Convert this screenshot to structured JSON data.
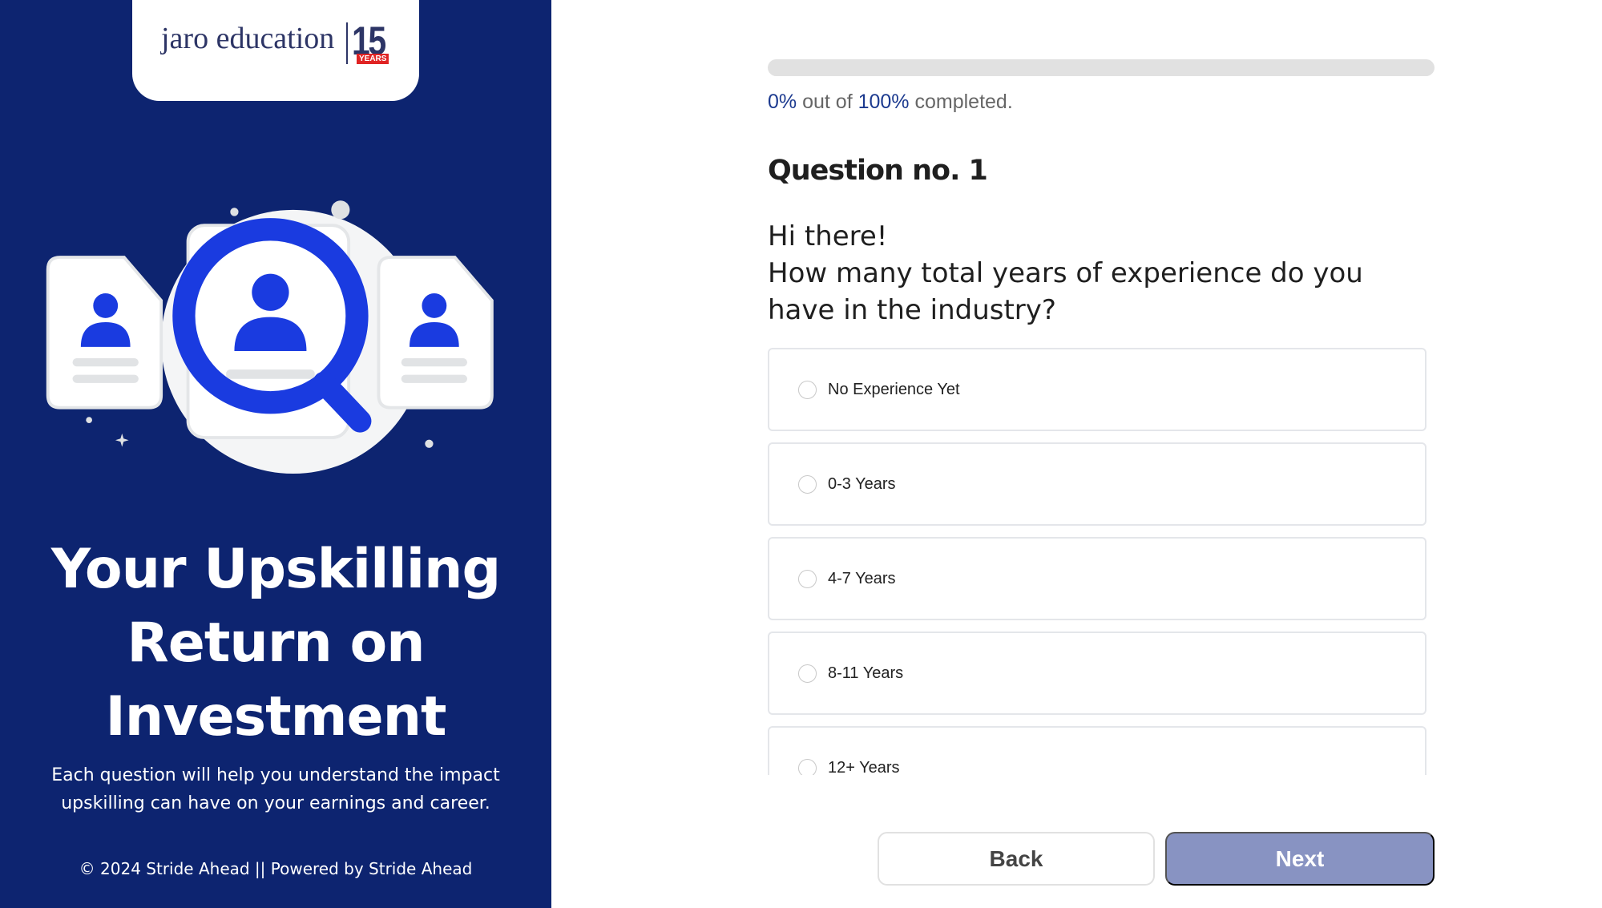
{
  "logo": {
    "name": "jaro education",
    "anniversary_number": "15",
    "anniversary_label": "YEARS"
  },
  "hero": {
    "title": "Your Upskilling Return on Investment",
    "subtitle": "Each question will help you understand the impact upskilling can have on your earnings and career.",
    "footer": "© 2024 Stride Ahead || Powered by Stride Ahead"
  },
  "progress": {
    "value_percent": 0,
    "current": "0%",
    "middle": " out of ",
    "total": "100%",
    "suffix": " completed."
  },
  "question": {
    "number_label": "Question no. 1",
    "greeting": "Hi there!",
    "text": "How many total years of experience do you have in the industry?"
  },
  "options": [
    {
      "label": "No Experience Yet"
    },
    {
      "label": "0-3 Years"
    },
    {
      "label": "4-7 Years"
    },
    {
      "label": "8-11 Years"
    },
    {
      "label": "12+ Years"
    }
  ],
  "buttons": {
    "back": "Back",
    "next": "Next"
  },
  "colors": {
    "panel": "#0d2470",
    "accent_blue": "#1a3be0",
    "next_disabled": "#8893c2"
  }
}
